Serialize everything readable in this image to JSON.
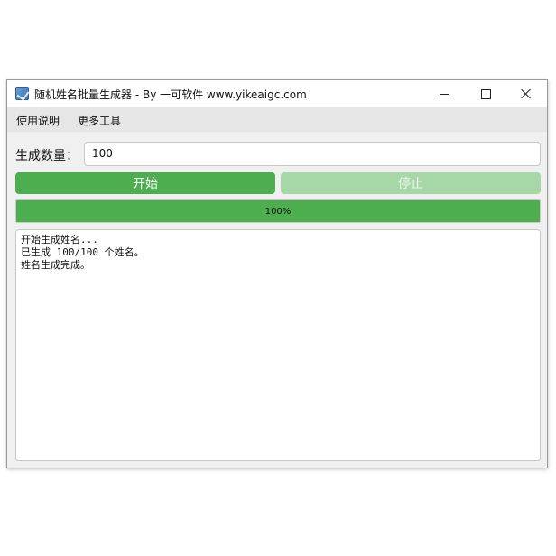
{
  "window": {
    "title": "随机姓名批量生成器 - By 一可软件 www.yikeaigc.com",
    "icon": "app-icon",
    "controls": [
      "minimize-icon",
      "maximize-icon",
      "close-icon"
    ]
  },
  "menu": {
    "items": [
      {
        "label": "使用说明"
      },
      {
        "label": "更多工具"
      }
    ]
  },
  "form": {
    "quantity_label": "生成数量：",
    "quantity_value": "100"
  },
  "buttons": {
    "start_label": "开始",
    "stop_label": "停止"
  },
  "progress": {
    "value": 1.0,
    "text": "100%"
  },
  "log": {
    "lines": [
      "开始生成姓名...",
      "已生成 100/100 个姓名。",
      "姓名生成完成。"
    ]
  },
  "colors": {
    "accent": "#4cae4f",
    "accent_disabled": "#a6d7a7"
  }
}
